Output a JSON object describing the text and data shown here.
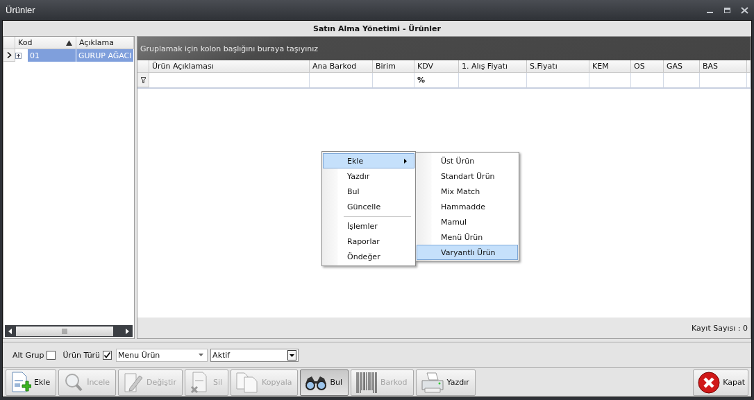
{
  "window": {
    "title": "Ürünler"
  },
  "header": "Satın Alma Yönetimi - Ürünler",
  "tree": {
    "columns": [
      {
        "label": "Kod",
        "sorted_ascending": true
      },
      {
        "label": "Açıklama",
        "sorted_ascending": false
      }
    ],
    "rows": [
      {
        "cells": [
          "01",
          "GURUP AĞACI"
        ],
        "selected": true,
        "expandable": true
      }
    ]
  },
  "grid": {
    "group_hint": "Gruplamak için kolon başlığını buraya taşıyınız",
    "columns": [
      {
        "label": "Ürün Açıklaması"
      },
      {
        "label": "Ana Barkod"
      },
      {
        "label": "Birim"
      },
      {
        "label": "KDV",
        "filter": "%"
      },
      {
        "label": "1. Alış Fiyatı"
      },
      {
        "label": "S.Fiyatı"
      },
      {
        "label": "KEM"
      },
      {
        "label": "OS"
      },
      {
        "label": "GAS"
      },
      {
        "label": "BAS"
      }
    ],
    "record_count": "Kayıt Sayısı : 0"
  },
  "filters": {
    "checks": [
      {
        "label": "Alt Grup",
        "checked": false
      },
      {
        "label": "Ürün Türü",
        "checked": true
      }
    ],
    "combos": [
      {
        "value": "Menu Ürün",
        "kind": "flat"
      },
      {
        "value": "Aktif",
        "kind": "boxed"
      }
    ]
  },
  "toolbar": [
    {
      "label": "Ekle",
      "kind": "new",
      "disabled": false,
      "pressed": false
    },
    {
      "label": "İncele",
      "kind": "view",
      "disabled": true,
      "pressed": false
    },
    {
      "label": "Değiştir",
      "kind": "edit",
      "disabled": true,
      "pressed": false
    },
    {
      "label": "Sil",
      "kind": "delete",
      "disabled": true,
      "pressed": false
    },
    {
      "label": "Kopyala",
      "kind": "copy",
      "disabled": true,
      "pressed": false
    },
    {
      "label": "Bul",
      "kind": "find",
      "disabled": false,
      "pressed": true
    },
    {
      "label": "Barkod",
      "kind": "barcode",
      "disabled": true,
      "pressed": false
    },
    {
      "label": "Yazdır",
      "kind": "print",
      "disabled": false,
      "pressed": false
    }
  ],
  "close_button": {
    "label": "Kapat"
  },
  "context_menu": {
    "items": [
      {
        "label": "Ekle",
        "selected": true,
        "submenu": true,
        "separator_before": false
      },
      {
        "label": "Yazdır",
        "selected": false,
        "submenu": false,
        "separator_before": false
      },
      {
        "label": "Bul",
        "selected": false,
        "submenu": false,
        "separator_before": false
      },
      {
        "label": "Güncelle",
        "selected": false,
        "submenu": false,
        "separator_before": false
      },
      {
        "label": "İşlemler",
        "selected": false,
        "submenu": false,
        "separator_before": true
      },
      {
        "label": "Raporlar",
        "selected": false,
        "submenu": false,
        "separator_before": false
      },
      {
        "label": "Öndeğer",
        "selected": false,
        "submenu": false,
        "separator_before": false
      }
    ]
  },
  "submenu": {
    "items": [
      {
        "label": "Üst Ürün",
        "selected": false
      },
      {
        "label": "Standart Ürün",
        "selected": false
      },
      {
        "label": "Mix Match",
        "selected": false
      },
      {
        "label": "Hammadde",
        "selected": false
      },
      {
        "label": "Mamul",
        "selected": false
      },
      {
        "label": "Menü Ürün",
        "selected": false
      },
      {
        "label": "Varyantlı Ürün",
        "selected": true
      }
    ]
  }
}
